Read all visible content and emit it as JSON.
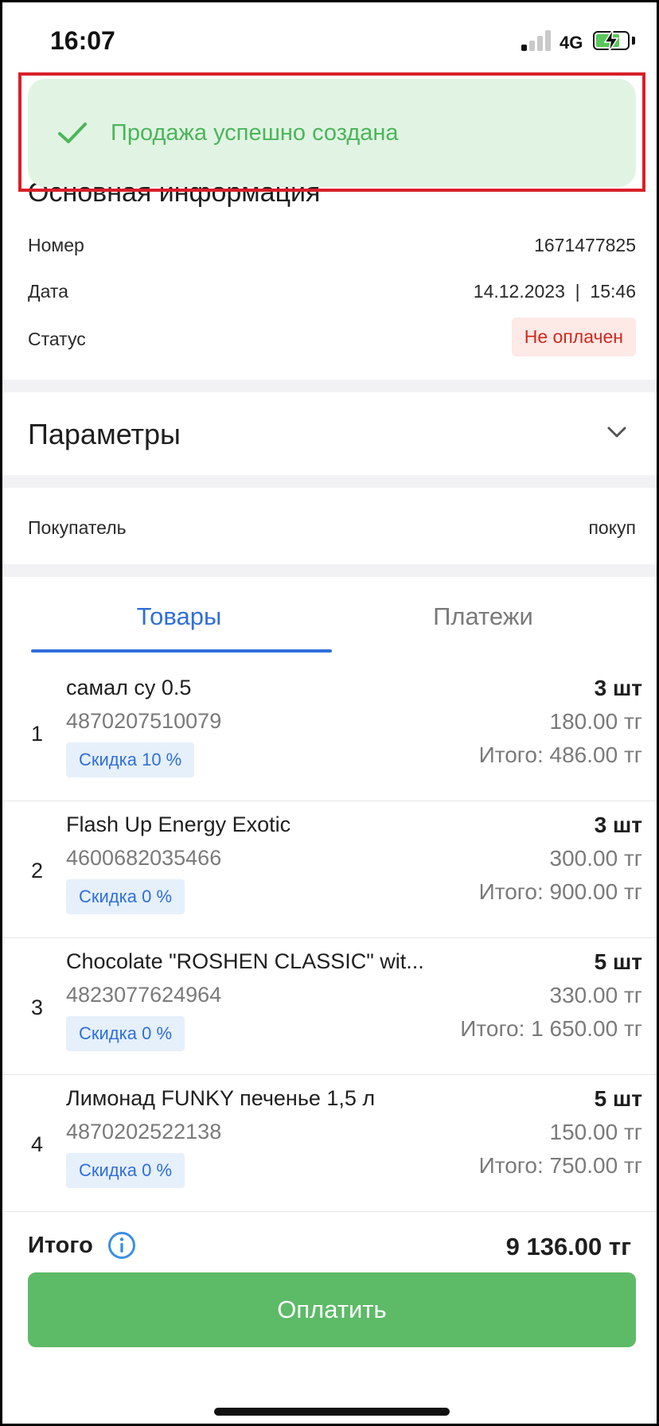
{
  "status_bar": {
    "time": "16:07",
    "network": "4G"
  },
  "toast": {
    "message": "Продажа успешно создана",
    "icon": "check-icon",
    "color": "#4cb55a"
  },
  "basic_info": {
    "title": "Основная информация",
    "number_label": "Номер",
    "number_value": "1671477825",
    "date_label": "Дата",
    "date_value": "14.12.2023  |  15:46",
    "status_label": "Статус",
    "status_value": "Не оплачен"
  },
  "params": {
    "title": "Параметры",
    "icon": "chevron-down-icon"
  },
  "buyer": {
    "label": "Покупатель",
    "value": "покуп"
  },
  "tabs": [
    {
      "label": "Товары",
      "active": true
    },
    {
      "label": "Платежи",
      "active": false
    }
  ],
  "items": [
    {
      "index": "1",
      "name": "самал су 0.5",
      "code": "4870207510079",
      "discount": "Скидка 10 %",
      "qty": "3 шт",
      "price": "180.00 тг",
      "total": "Итого: 486.00 тг"
    },
    {
      "index": "2",
      "name": "Flash Up Energy Exotic",
      "code": "4600682035466",
      "discount": "Скидка 0 %",
      "qty": "3 шт",
      "price": "300.00 тг",
      "total": "Итого: 900.00 тг"
    },
    {
      "index": "3",
      "name": "Chocolate \"ROSHEN CLASSIC\" wit...",
      "code": "4823077624964",
      "discount": "Скидка 0 %",
      "qty": "5 шт",
      "price": "330.00 тг",
      "total": "Итого: 1 650.00 тг"
    },
    {
      "index": "4",
      "name": "Лимонад FUNKY печенье 1,5 л",
      "code": "4870202522138",
      "discount": "Скидка 0 %",
      "qty": "5 шт",
      "price": "150.00 тг",
      "total": "Итого: 750.00 тг"
    }
  ],
  "summary": {
    "total_label": "Итого",
    "total_value": "9 136.00 тг",
    "info_icon": "info-icon"
  },
  "pay_button": {
    "label": "Оплатить",
    "color": "#5dba67"
  },
  "colors": {
    "accent": "#2f6fdb",
    "success": "#4cb55a",
    "danger": "#d02a1e"
  }
}
